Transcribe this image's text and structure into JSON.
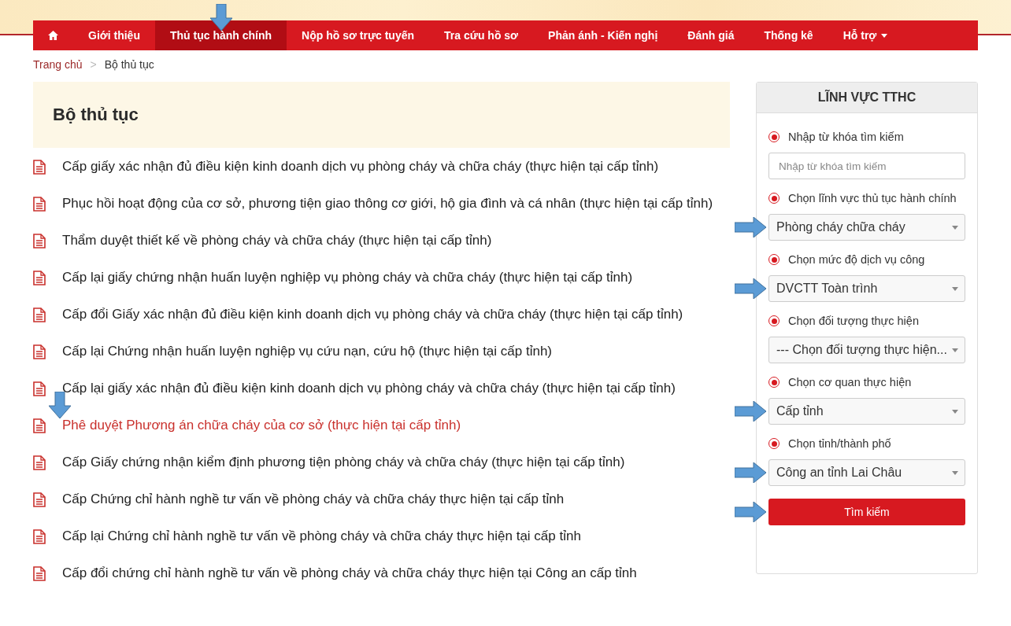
{
  "nav": {
    "items": [
      {
        "kind": "home",
        "selected": false,
        "annotated": false
      },
      {
        "kind": "link",
        "label": "Giới thiệu",
        "selected": false,
        "annotated": false
      },
      {
        "kind": "link",
        "label": "Thủ tục hành chính",
        "selected": true,
        "annotated": true
      },
      {
        "kind": "link",
        "label": "Nộp hồ sơ trực tuyến",
        "selected": false,
        "annotated": false
      },
      {
        "kind": "link",
        "label": "Tra cứu hồ sơ",
        "selected": false,
        "annotated": false
      },
      {
        "kind": "link",
        "label": "Phản ánh - Kiến nghị",
        "selected": false,
        "annotated": false
      },
      {
        "kind": "link",
        "label": "Đánh giá",
        "selected": false,
        "annotated": false
      },
      {
        "kind": "link",
        "label": "Thống kê",
        "selected": false,
        "annotated": false
      },
      {
        "kind": "dropdown",
        "label": "Hỗ trợ",
        "selected": false,
        "annotated": false
      }
    ]
  },
  "breadcrumb": [
    "Trang chủ",
    "Bộ thủ tục"
  ],
  "breadcrumb_separator": ">",
  "title": "Bộ thủ tục",
  "procedures": [
    {
      "label": "Cấp giấy xác nhận đủ điều kiện kinh doanh dịch vụ phòng cháy và chữa cháy (thực hiện tại cấp tỉnh)",
      "selected": false,
      "annotated": false
    },
    {
      "label": "Phục hồi hoạt động của cơ sở, phương tiện giao thông cơ giới, hộ gia đình và cá nhân (thực hiện tại cấp tỉnh)",
      "selected": false,
      "annotated": false
    },
    {
      "label": "Thẩm duyệt thiết kế về phòng cháy và chữa cháy (thực hiện tại cấp tỉnh)",
      "selected": false,
      "annotated": false
    },
    {
      "label": "Cấp lại giấy chứng nhận huấn luyện nghiệp vụ phòng cháy và chữa cháy (thực hiện tại cấp tỉnh)",
      "selected": false,
      "annotated": false
    },
    {
      "label": "Cấp đổi Giấy xác nhận đủ điều kiện kinh doanh dịch vụ phòng cháy và chữa cháy (thực hiện tại cấp tỉnh)",
      "selected": false,
      "annotated": false
    },
    {
      "label": "Cấp lại Chứng nhận huấn luyện nghiệp vụ cứu nạn, cứu hộ (thực hiện tại cấp tỉnh)",
      "selected": false,
      "annotated": false
    },
    {
      "label": "Cấp lại giấy xác nhận đủ điều kiện kinh doanh dịch vụ phòng cháy và chữa cháy (thực hiện tại cấp tỉnh)",
      "selected": false,
      "annotated": false
    },
    {
      "label": "Phê duyệt Phương án chữa cháy của cơ sở (thực hiện tại cấp tỉnh)",
      "selected": true,
      "annotated": true
    },
    {
      "label": "Cấp Giấy chứng nhận kiểm định phương tiện phòng cháy và chữa cháy (thực hiện tại cấp tỉnh)",
      "selected": false,
      "annotated": false
    },
    {
      "label": "Cấp Chứng chỉ hành nghề tư vấn về phòng cháy và chữa cháy thực hiện tại cấp tỉnh",
      "selected": false,
      "annotated": false
    },
    {
      "label": "Cấp lại Chứng chỉ hành nghề tư vấn về phòng cháy và chữa cháy thực hiện tại cấp tỉnh",
      "selected": false,
      "annotated": false
    },
    {
      "label": "Cấp đổi chứng chỉ hành nghề tư vấn về phòng cháy và chữa cháy thực hiện tại Công an cấp tỉnh",
      "selected": false,
      "annotated": false
    }
  ],
  "filter": {
    "title": "LĨNH VỰC TTHC",
    "fields": [
      {
        "kind": "text",
        "label": "Nhập từ khóa tìm kiếm",
        "checked": true,
        "placeholder": "Nhập từ khóa tìm kiếm",
        "annotated": false
      },
      {
        "kind": "select",
        "label": "Chọn lĩnh vực thủ tục hành chính",
        "checked": true,
        "value": "Phòng cháy chữa cháy",
        "annotated": true
      },
      {
        "kind": "select",
        "label": "Chọn mức độ dịch vụ công",
        "checked": true,
        "value": "DVCTT Toàn trình",
        "annotated": true
      },
      {
        "kind": "select",
        "label": "Chọn đối tượng thực hiện",
        "checked": true,
        "value": "--- Chọn đối tượng thực hiện...",
        "annotated": false
      },
      {
        "kind": "select",
        "label": "Chọn cơ quan thực hiện",
        "checked": true,
        "value": "Cấp tỉnh",
        "annotated": true
      },
      {
        "kind": "select",
        "label": "Chọn tỉnh/thành phố",
        "checked": true,
        "value": "Công an tỉnh Lai Châu",
        "annotated": true
      }
    ],
    "button": {
      "label": "Tìm kiếm",
      "annotated": true
    }
  }
}
